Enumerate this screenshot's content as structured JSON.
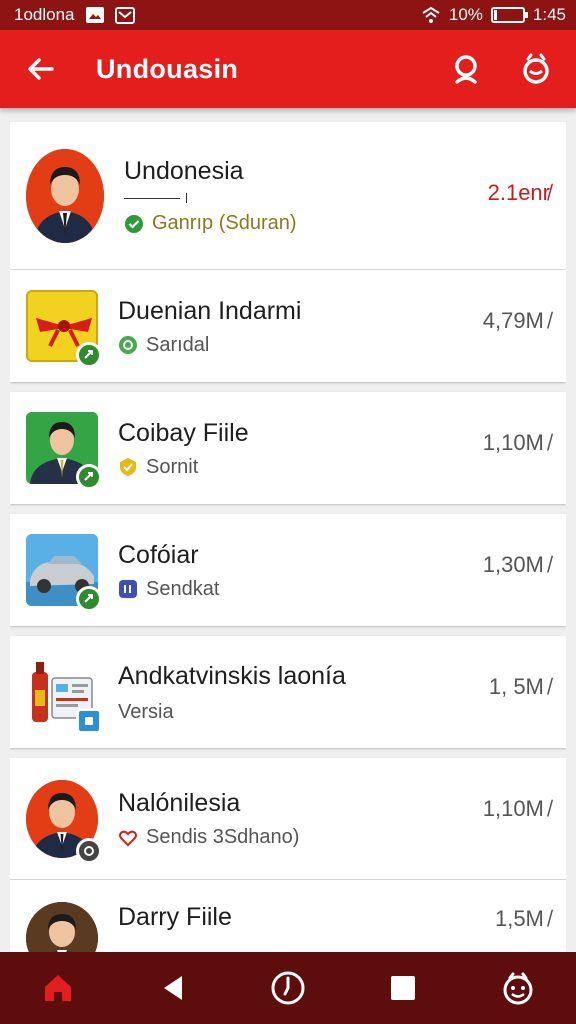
{
  "status": {
    "carrier": "1odlona",
    "battery": "10%",
    "battery_level": 0.1,
    "time": "1:45"
  },
  "appbar": {
    "title": "Undouasin",
    "back_icon": "arrow-left-icon",
    "search_icon": "search-icon",
    "account_icon": "account-icon"
  },
  "colors": {
    "primary": "#e41d1d",
    "status_bar": "#8e1414",
    "nav_bar": "#5e0d0d",
    "badge_green": "#2e8b2e",
    "highlight_red": "#c81d1d"
  },
  "items": [
    {
      "name": "Undonesia",
      "sub": "Ganrıp (Sduran)",
      "size": "2.1enr̸"
    },
    {
      "name": "Duenian Indarmi",
      "sub": "Sarıdal",
      "size": "4,79M ̸"
    },
    {
      "name": "Coibay Fiile",
      "sub": "Sornit",
      "size": "1,10M ̸"
    },
    {
      "name": "Cofóiar",
      "sub": "Sendkat",
      "size": "1,30M ̸"
    },
    {
      "name": "Andkatvinskis laonía",
      "sub": "Versia",
      "size": "1, 5M ̸"
    },
    {
      "name": "Nalónilesia",
      "sub": "Sendis 3Sdhano)",
      "size": "1,10M ̸"
    },
    {
      "name": "Darry Fiile",
      "sub": "",
      "size": "1,5M ̸"
    }
  ],
  "navbar": {
    "home_icon": "home-icon",
    "back_icon": "triangle-back-icon",
    "clock_icon": "clock-icon",
    "recents_icon": "square-recents-icon",
    "assistant_icon": "assistant-icon"
  }
}
